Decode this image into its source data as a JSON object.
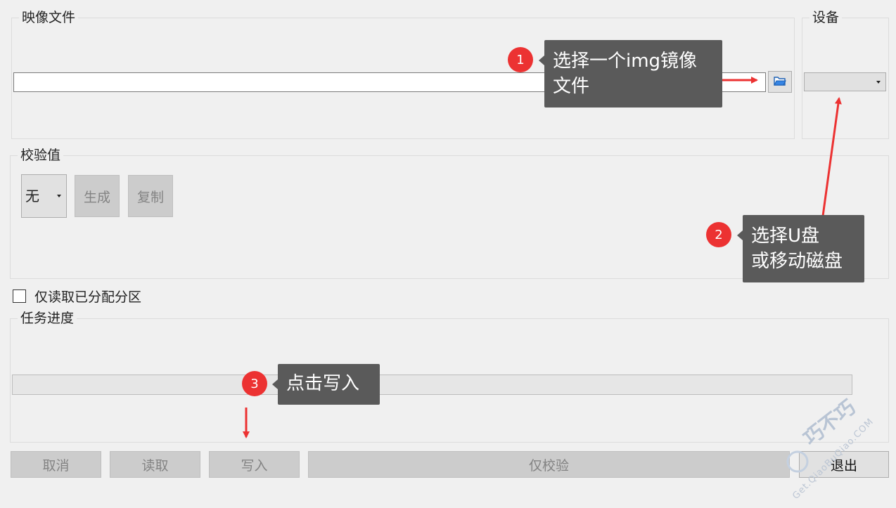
{
  "image_file": {
    "group_title": "映像文件",
    "path_value": "",
    "browse_icon": "folder-open-icon"
  },
  "device": {
    "group_title": "设备",
    "selected": ""
  },
  "hash": {
    "group_title": "校验值",
    "selected": "无",
    "generate_label": "生成",
    "copy_label": "复制"
  },
  "read_only_allocated": {
    "label": "仅读取已分配分区",
    "checked": false
  },
  "progress": {
    "group_title": "任务进度",
    "value": 0
  },
  "buttons": {
    "cancel": "取消",
    "read": "读取",
    "write": "写入",
    "verify_only": "仅校验",
    "exit": "退出"
  },
  "annotations": {
    "step1": {
      "number": "1",
      "text_line1": "选择一个img镜像",
      "text_line2": "文件"
    },
    "step2": {
      "number": "2",
      "text_line1": "选择U盘",
      "text_line2": "或移动磁盘"
    },
    "step3": {
      "number": "3",
      "text_line1": "点击写入"
    },
    "color": "#ec3232",
    "tip_bg": "#5a5a5a"
  },
  "watermark": {
    "brand": "巧不巧",
    "site": "Get.QiaoBuQiao.COM"
  }
}
